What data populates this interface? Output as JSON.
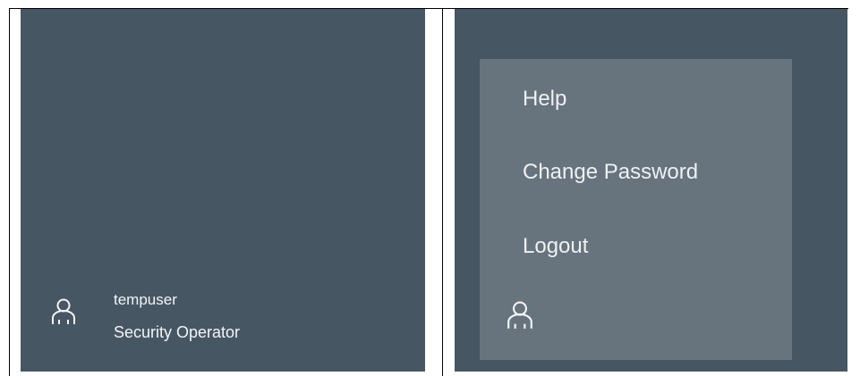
{
  "left": {
    "user": {
      "icon": "user-icon",
      "name": "tempuser",
      "role": "Security Operator"
    }
  },
  "right": {
    "menu": {
      "items": [
        {
          "label": "Help"
        },
        {
          "label": "Change Password"
        },
        {
          "label": "Logout"
        }
      ],
      "user_icon": "user-icon"
    }
  },
  "colors": {
    "panel_bg": "#475663",
    "menu_bg": "#67737d",
    "text": "#eef1f3"
  }
}
